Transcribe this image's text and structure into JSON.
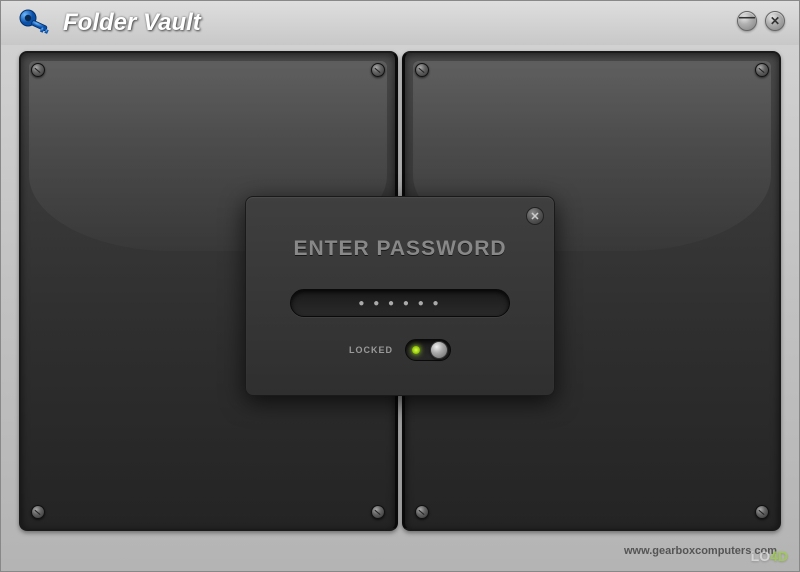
{
  "app": {
    "title": "Folder Vault"
  },
  "dialog": {
    "title": "ENTER PASSWORD",
    "password_mask": "● ● ● ● ● ●",
    "lock_label": "LOCKED"
  },
  "footer": {
    "url": "www.gearboxcomputers.com"
  },
  "watermark": {
    "prefix": "LO",
    "suffix": "4D"
  }
}
